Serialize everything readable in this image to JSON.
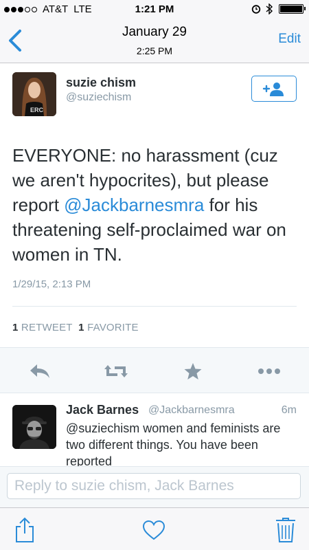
{
  "status_bar": {
    "carrier": "AT&T",
    "network": "LTE",
    "time": "1:21 PM"
  },
  "nav": {
    "title": "January 29",
    "subtitle": "2:25 PM",
    "edit_label": "Edit"
  },
  "tweet": {
    "author_name": "suzie chism",
    "author_handle": "@suziechism",
    "text_before": "EVERYONE: no harassment (cuz we aren't hypocrites), but please report ",
    "mention": "@Jackbarnesmra",
    "text_after": " for his threatening self-proclaimed war on women in TN.",
    "timestamp": "1/29/15, 2:13 PM",
    "retweet_count": "1",
    "retweet_label": "RETWEET",
    "favorite_count": "1",
    "favorite_label": "FAVORITE"
  },
  "reply": {
    "author_name": "Jack Barnes",
    "author_handle": "@Jackbarnesmra",
    "time": "6m",
    "text": "@suziechism women and feminists are two different things. You have been reported"
  },
  "composer": {
    "placeholder": "Reply to suzie chism, Jack Barnes"
  },
  "icons": {
    "back": "chevron-left-icon",
    "follow": "add-user-icon",
    "reply": "reply-icon",
    "retweet": "retweet-icon",
    "favorite": "star-icon",
    "more": "more-icon",
    "share": "share-icon",
    "heart": "heart-icon",
    "trash": "trash-icon"
  },
  "colors": {
    "accent": "#2a8bd8",
    "muted": "#8899a6",
    "text": "#292f33"
  }
}
